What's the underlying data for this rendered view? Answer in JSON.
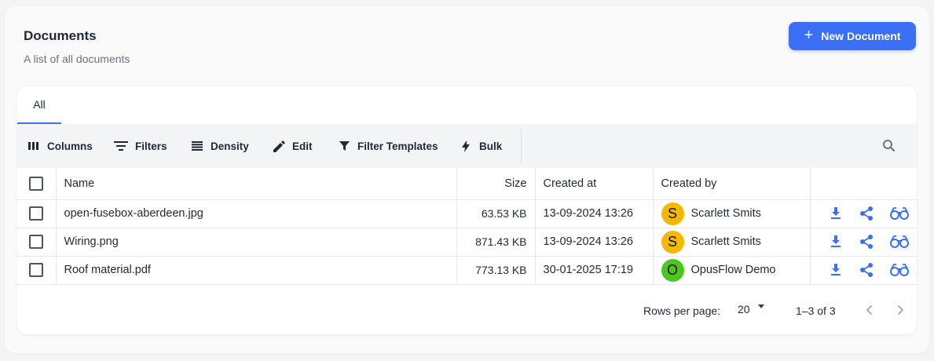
{
  "header": {
    "title": "Documents",
    "subtitle": "A list of all documents",
    "new_button_label": "New Document",
    "new_button_icon": "plus-icon"
  },
  "tabs": [
    {
      "label": "All",
      "active": true
    }
  ],
  "toolbar": {
    "columns_label": "Columns",
    "filters_label": "Filters",
    "density_label": "Density",
    "edit_label": "Edit",
    "filter_templates_label": "Filter Templates",
    "bulk_label": "Bulk"
  },
  "table": {
    "headers": {
      "name": "Name",
      "size": "Size",
      "created_at": "Created at",
      "created_by": "Created by"
    },
    "rows": [
      {
        "name": "open-fusebox-aberdeen.jpg",
        "size": "63.53 KB",
        "created_at": "13-09-2024 13:26",
        "created_by": "Scarlett Smits",
        "avatar_letter": "S",
        "avatar_color": "#f5b800"
      },
      {
        "name": "Wiring.png",
        "size": "871.43 KB",
        "created_at": "13-09-2024 13:26",
        "created_by": "Scarlett Smits",
        "avatar_letter": "S",
        "avatar_color": "#f5b800"
      },
      {
        "name": "Roof material.pdf",
        "size": "773.13 KB",
        "created_at": "30-01-2025 17:19",
        "created_by": "OpusFlow Demo",
        "avatar_letter": "O",
        "avatar_color": "#4cc71f"
      }
    ],
    "row_actions": [
      "download-icon",
      "share-icon",
      "view-icon"
    ]
  },
  "pagination": {
    "rows_per_page_label": "Rows per page:",
    "rows_per_page_value": "20",
    "range": "1–3 of 3"
  },
  "colors": {
    "accent": "#3b6ff5",
    "toolbar_bg": "#f3f4f6"
  }
}
